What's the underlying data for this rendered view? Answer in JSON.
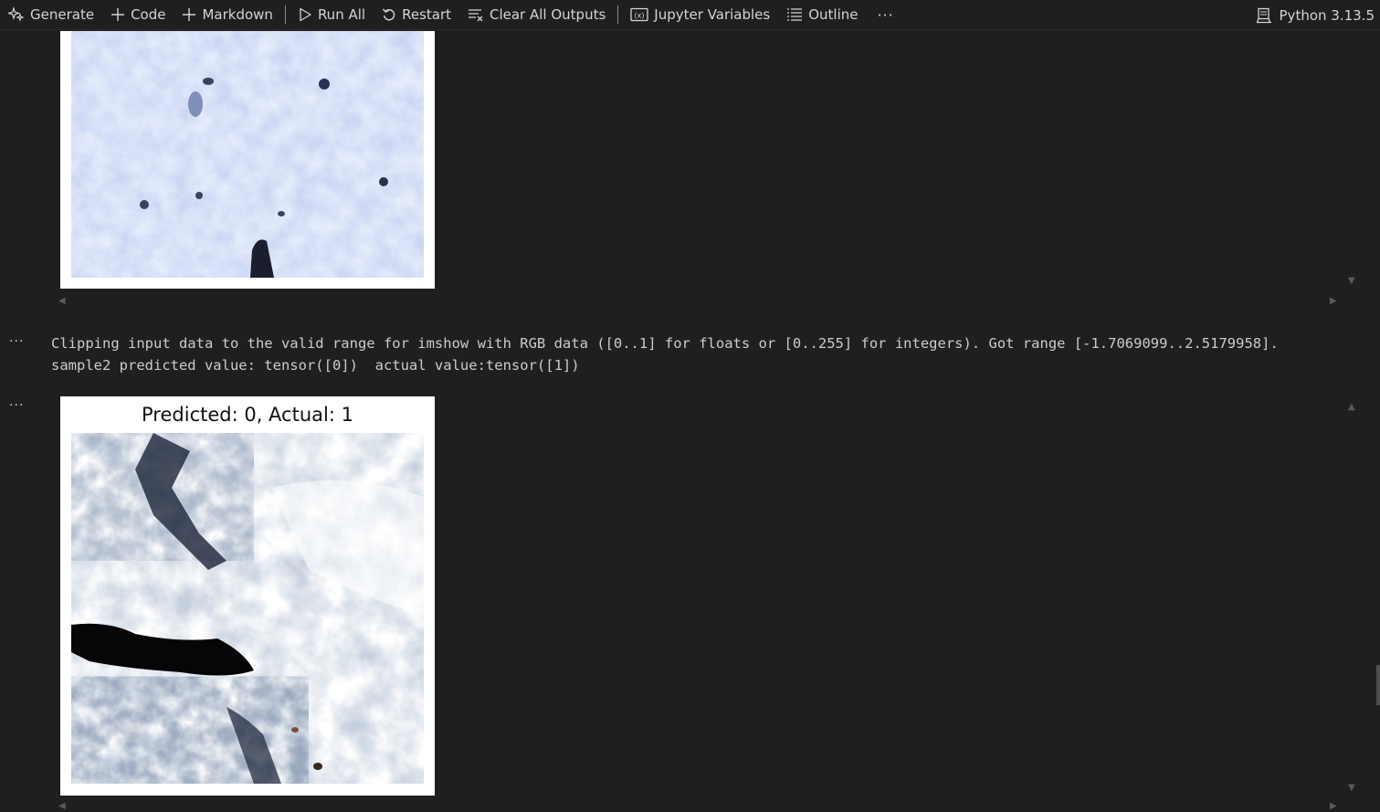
{
  "toolbar": {
    "generate": "Generate",
    "code": "Code",
    "markdown": "Markdown",
    "run_all": "Run All",
    "restart": "Restart",
    "clear_all_outputs": "Clear All Outputs",
    "jupyter_variables": "Jupyter Variables",
    "outline": "Outline",
    "more": "···",
    "kernel": "Python 3.13.5"
  },
  "cells": [
    {
      "collapse": "···"
    },
    {
      "collapse": "···"
    }
  ],
  "output": {
    "line1": "Clipping input data to the valid range for imshow with RGB data ([0..1] for floats or [0..255] for integers). Got range [-1.7069099..2.5179958].",
    "line2": "sample2 predicted value: tensor([0])  actual value:tensor([1])",
    "plot_title": "Predicted: 0, Actual: 1"
  },
  "colors": {
    "background": "#1f1f1f",
    "text": "#cccccc",
    "image_bg": "#ffffff"
  },
  "icons": [
    "sparkle-icon",
    "plus-icon",
    "play-icon",
    "restart-icon",
    "clear-outputs-icon",
    "variables-icon",
    "outline-icon",
    "more-icon",
    "kernel-icon"
  ]
}
